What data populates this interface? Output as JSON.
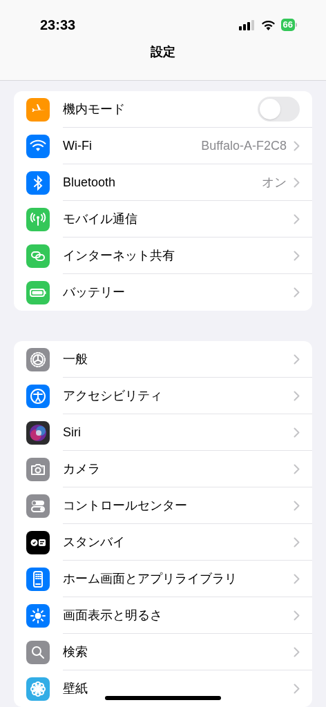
{
  "status_bar": {
    "time": "23:33",
    "battery": "66"
  },
  "title": "設定",
  "groups": [
    {
      "rows": [
        {
          "kind": "toggle",
          "label": "機内モード",
          "on": false
        },
        {
          "kind": "link",
          "label": "Wi-Fi",
          "value": "Buffalo-A-F2C8"
        },
        {
          "kind": "link",
          "label": "Bluetooth",
          "value": "オン"
        },
        {
          "kind": "link",
          "label": "モバイル通信"
        },
        {
          "kind": "link",
          "label": "インターネット共有"
        },
        {
          "kind": "link",
          "label": "バッテリー"
        }
      ]
    },
    {
      "rows": [
        {
          "kind": "link",
          "label": "一般"
        },
        {
          "kind": "link",
          "label": "アクセシビリティ"
        },
        {
          "kind": "link",
          "label": "Siri"
        },
        {
          "kind": "link",
          "label": "カメラ"
        },
        {
          "kind": "link",
          "label": "コントロールセンター"
        },
        {
          "kind": "link",
          "label": "スタンバイ"
        },
        {
          "kind": "link",
          "label": "ホーム画面とアプリライブラリ"
        },
        {
          "kind": "link",
          "label": "画面表示と明るさ"
        },
        {
          "kind": "link",
          "label": "検索"
        },
        {
          "kind": "link",
          "label": "壁紙"
        }
      ]
    }
  ]
}
